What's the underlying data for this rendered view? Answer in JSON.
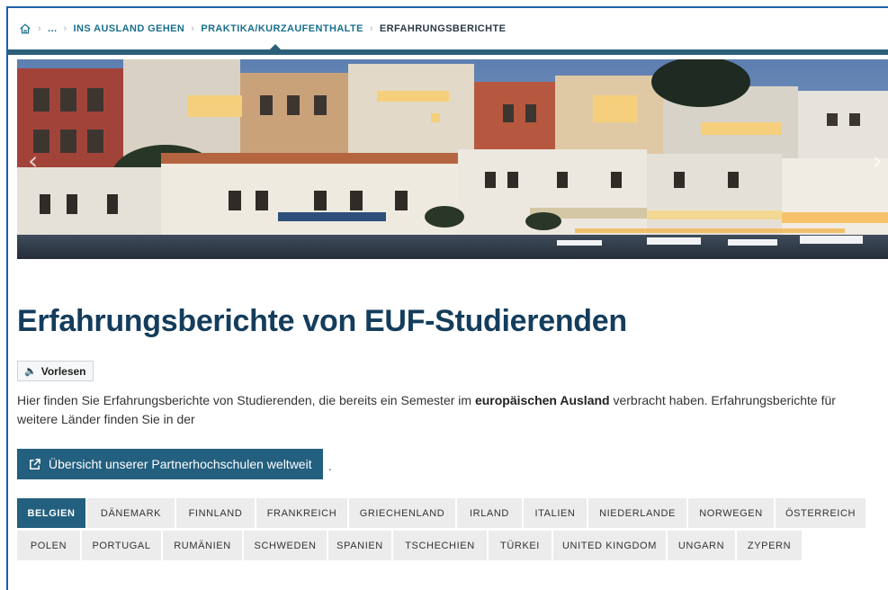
{
  "breadcrumb": {
    "ellipsis": "...",
    "items": [
      "INS AUSLAND GEHEN",
      "PRAKTIKA/KURZAUFENTHALTE",
      "ERFAHRUNGSBERICHTE"
    ]
  },
  "hero": {
    "prev_icon": "chevron-left-icon",
    "next_icon": "chevron-right-icon",
    "prev_glyph": "‹",
    "next_glyph": "›"
  },
  "page": {
    "title": "Erfahrungsberichte von EUF-Studierenden",
    "read_aloud_label": "Vorlesen",
    "read_aloud_icon": "🔈",
    "intro_part1": "Hier finden Sie Erfahrungsberichte von Studierenden, die bereits ein Semester im ",
    "intro_bold": "europäischen Ausland",
    "intro_part2": " verbracht haben. Erfahrungsberichte für weitere Länder finden Sie in der",
    "partner_button": "Übersicht unserer Partnerhochschulen weltweit",
    "after_button": "."
  },
  "tabs": {
    "row1": [
      "BELGIEN",
      "DÄNEMARK",
      "FINNLAND",
      "FRANKREICH",
      "GRIECHENLAND",
      "IRLAND",
      "ITALIEN",
      "NIEDERLANDE",
      "NORWEGEN",
      "ÖSTERREICH"
    ],
    "row2": [
      "POLEN",
      "PORTUGAL",
      "RUMÄNIEN",
      "SCHWEDEN",
      "SPANIEN",
      "TSCHECHIEN",
      "TÜRKEI",
      "UNITED KINGDOM",
      "UNGARN",
      "ZYPERN"
    ],
    "active": "BELGIEN"
  },
  "colors": {
    "accent": "#235f7e",
    "title": "#143d5c",
    "breadcrumb_link": "#1a6f8e",
    "frame_border": "#1e5fa5"
  }
}
